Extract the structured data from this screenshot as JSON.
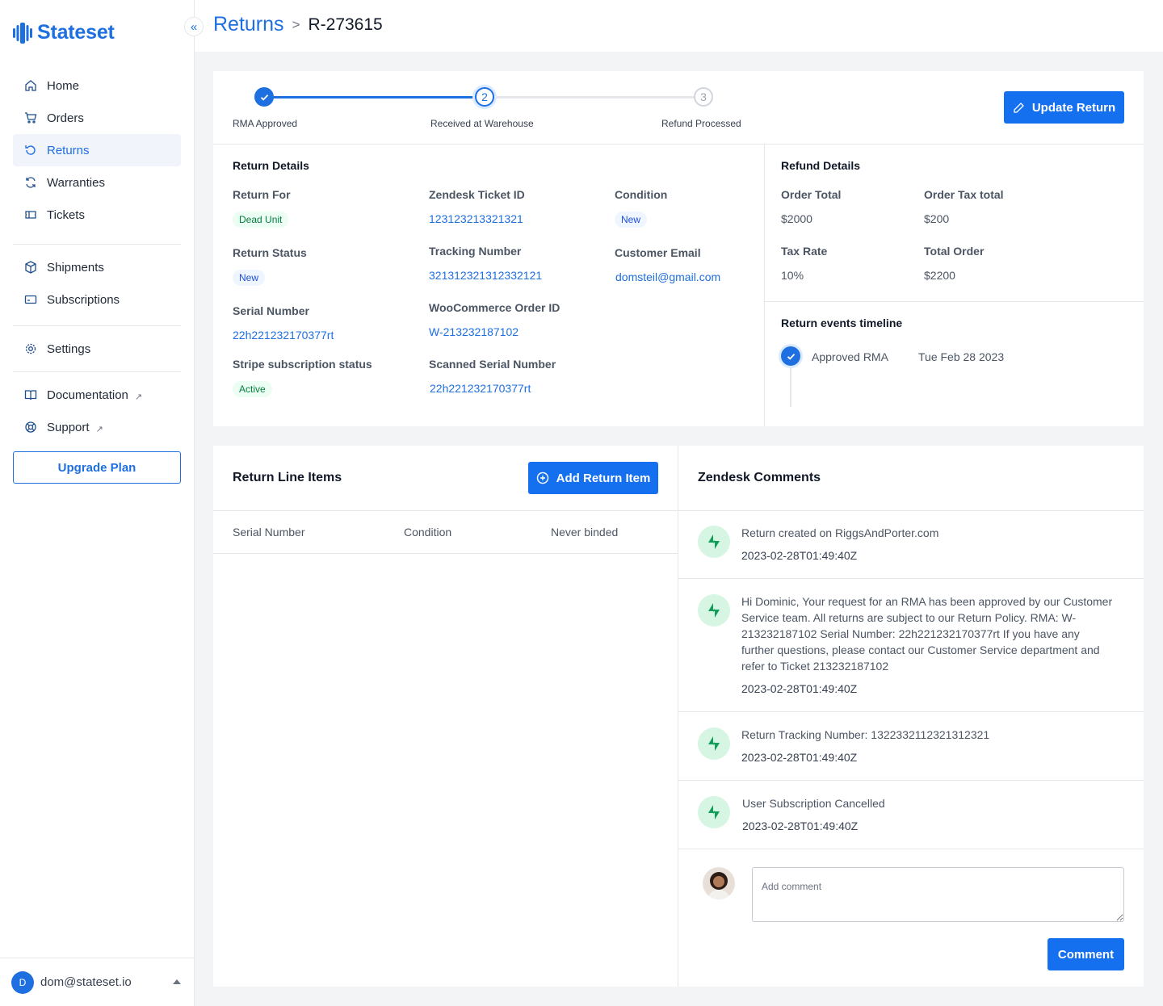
{
  "brand": {
    "name": "Stateset",
    "accent": "#1e6fe0"
  },
  "sidebar": {
    "items": [
      {
        "label": "Home",
        "icon": "home-icon"
      },
      {
        "label": "Orders",
        "icon": "cart-icon"
      },
      {
        "label": "Returns",
        "icon": "returns-icon",
        "active": true
      },
      {
        "label": "Warranties",
        "icon": "refresh-icon"
      },
      {
        "label": "Tickets",
        "icon": "ticket-icon"
      },
      {
        "label": "Shipments",
        "icon": "box-icon"
      },
      {
        "label": "Subscriptions",
        "icon": "card-icon"
      },
      {
        "label": "Settings",
        "icon": "gear-icon"
      },
      {
        "label": "Documentation",
        "icon": "book-icon",
        "external": true
      },
      {
        "label": "Support",
        "icon": "lifebuoy-icon",
        "external": true
      }
    ],
    "external_glyph": "↗",
    "upgrade_label": "Upgrade Plan",
    "user": {
      "initial": "D",
      "email": "dom@stateset.io"
    }
  },
  "header": {
    "breadcrumb_root": "Returns",
    "separator": ">",
    "current": "R-273615"
  },
  "progress": {
    "steps": [
      {
        "label": "RMA Approved",
        "number": "1",
        "status": "complete"
      },
      {
        "label": "Received at Warehouse",
        "number": "2",
        "status": "current"
      },
      {
        "label": "Refund Processed",
        "number": "3",
        "status": "upcoming"
      }
    ],
    "update_label": "Update Return"
  },
  "return_details": {
    "title": "Return Details",
    "return_for": {
      "label": "Return For",
      "value": "Dead Unit"
    },
    "return_status": {
      "label": "Return Status",
      "value": "New"
    },
    "serial_number": {
      "label": "Serial Number",
      "value": "22h221232170377rt"
    },
    "stripe_status": {
      "label": "Stripe subscription status",
      "value": "Active"
    },
    "zendesk_ticket": {
      "label": "Zendesk Ticket ID",
      "value": "123123213321321"
    },
    "tracking_number": {
      "label": "Tracking Number",
      "value": "321312321312332121"
    },
    "woo_order": {
      "label": "WooCommerce Order ID",
      "value": "W-213232187102"
    },
    "scanned_serial": {
      "label": "Scanned Serial Number",
      "value": "22h221232170377rt"
    },
    "condition": {
      "label": "Condition",
      "value": "New"
    },
    "customer_email": {
      "label": "Customer Email",
      "value": "domsteil@gmail.com"
    }
  },
  "refund_details": {
    "title": "Refund Details",
    "order_total": {
      "label": "Order Total",
      "value": "$2000"
    },
    "order_tax_total": {
      "label": "Order Tax total",
      "value": "$200"
    },
    "tax_rate": {
      "label": "Tax Rate",
      "value": "10%"
    },
    "total_order": {
      "label": "Total Order",
      "value": "$2200"
    }
  },
  "timeline": {
    "title": "Return events timeline",
    "events": [
      {
        "label": "Approved RMA",
        "date": "Tue Feb 28 2023"
      }
    ]
  },
  "line_items": {
    "title": "Return Line Items",
    "add_label": "Add Return Item",
    "columns": [
      "Serial Number",
      "Condition",
      "Never binded"
    ],
    "rows": []
  },
  "comments": {
    "title": "Zendesk Comments",
    "items": [
      {
        "text": "Return created on RiggsAndPorter.com",
        "time": "2023-02-28T01:49:40Z"
      },
      {
        "text": "Hi Dominic, Your request for an RMA has been approved by our Customer Service team. All returns are subject to our Return Policy. RMA: W-213232187102 Serial Number: 22h221232170377rt If you have any further questions, please contact our Customer Service department and refer to Ticket 213232187102",
        "time": "2023-02-28T01:49:40Z"
      },
      {
        "text": "Return Tracking Number: 1322332112321312321",
        "time": "2023-02-28T01:49:40Z"
      },
      {
        "text": "User Subscription Cancelled",
        "time": "2023-02-28T01:49:40Z"
      }
    ],
    "input_placeholder": "Add comment",
    "submit_label": "Comment"
  }
}
